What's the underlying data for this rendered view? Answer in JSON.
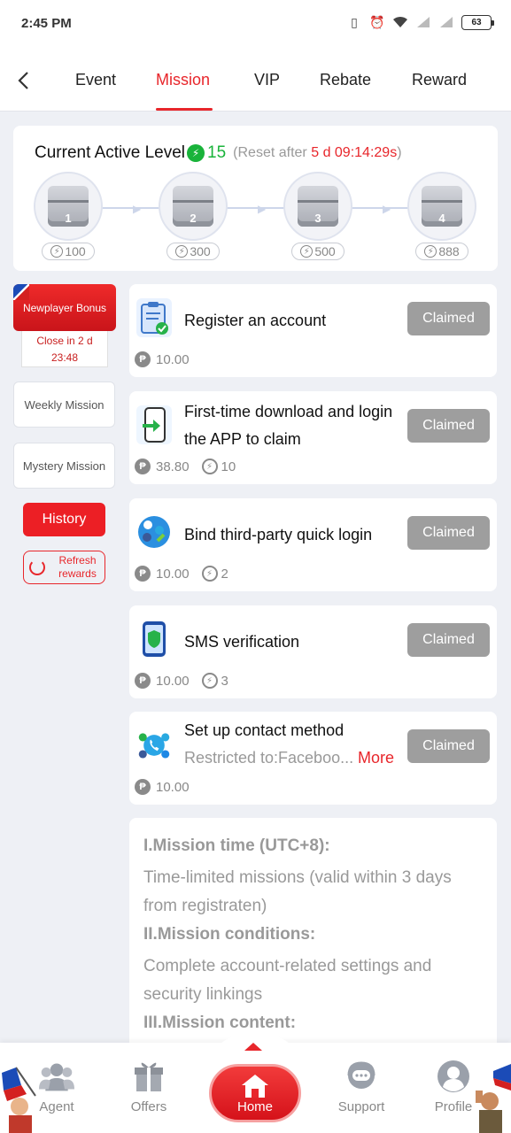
{
  "status_bar": {
    "time": "2:45 PM",
    "battery": "63"
  },
  "tabs": [
    {
      "label": "Event"
    },
    {
      "label": "Mission"
    },
    {
      "label": "VIP"
    },
    {
      "label": "Rebate"
    },
    {
      "label": "Reward"
    }
  ],
  "active_level": {
    "title": "Current Active Level",
    "level": "15",
    "reset_prefix": "(Reset after",
    "reset_time": "5 d 09:14:29s",
    "reset_suffix": ")",
    "chests": [
      {
        "num": "1",
        "points": "100"
      },
      {
        "num": "2",
        "points": "300"
      },
      {
        "num": "3",
        "points": "500"
      },
      {
        "num": "4",
        "points": "888"
      }
    ]
  },
  "sidebar": {
    "newplayer_label": "Newplayer Bonus",
    "close_line1": "Close in 2 d",
    "close_line2": "23:48",
    "weekly": "Weekly Mission",
    "mystery": "Mystery Mission",
    "history": "History",
    "refresh_line1": "Refresh",
    "refresh_line2": "rewards"
  },
  "missions": [
    {
      "title": "Register an account",
      "status": "Claimed",
      "coins": "10.00",
      "exp": ""
    },
    {
      "title": "First-time download and login the APP to claim",
      "status": "Claimed",
      "coins": "38.80",
      "exp": "10"
    },
    {
      "title": "Bind third-party quick login",
      "status": "Claimed",
      "coins": "10.00",
      "exp": "2"
    },
    {
      "title": "SMS verification",
      "status": "Claimed",
      "coins": "10.00",
      "exp": "3"
    },
    {
      "title": "Set up contact method",
      "subtitle": "Restricted to:Faceboo...",
      "more": "More",
      "status": "Claimed",
      "coins": "10.00",
      "exp": ""
    }
  ],
  "rules": {
    "h1": "I.Mission time (UTC+8):",
    "p1": "Time-limited missions (valid within 3 days from registraten)",
    "h2": "II.Mission conditions:",
    "p2": "Complete account-related settings and security linkings",
    "h3": "III.Mission content:"
  },
  "bottom_nav": {
    "agent": "Agent",
    "offers": "Offers",
    "home": "Home",
    "support": "Support",
    "profile": "Profile"
  },
  "colors": {
    "accent": "#e8262b",
    "green": "#19b33a",
    "claimed_bg": "#9e9e9e"
  }
}
